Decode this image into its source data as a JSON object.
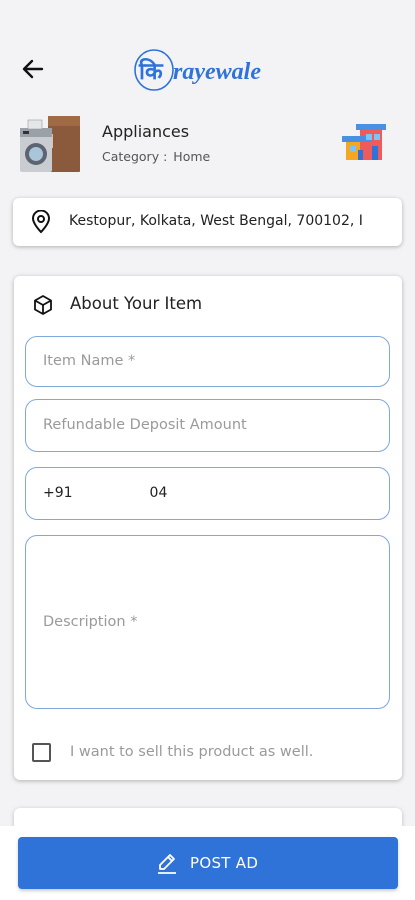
{
  "header": {
    "logo_prefix": "कि",
    "logo_word": "rayewale",
    "brand_color": "#2f73d8"
  },
  "category": {
    "name": "Appliances",
    "subtitle_label": "Category :",
    "subtitle_value": "Home"
  },
  "location": {
    "address": "Kestopur, Kolkata, West Bengal, 700102, I"
  },
  "item_card": {
    "title": "About Your Item",
    "item_name_placeholder": "Item Name *",
    "deposit_placeholder": "Refundable Deposit Amount",
    "phone_prefix": "+91",
    "phone_suffix": "04",
    "description_placeholder": "Description *",
    "sell_checkbox_label": "I want to sell this product as well.",
    "sell_checked": false
  },
  "actions": {
    "post_label": "POST AD"
  },
  "icons": {
    "back": "arrow-left-icon",
    "location": "map-pin-icon",
    "box": "cube-icon",
    "edit": "pencil-icon",
    "home": "house-icon"
  }
}
